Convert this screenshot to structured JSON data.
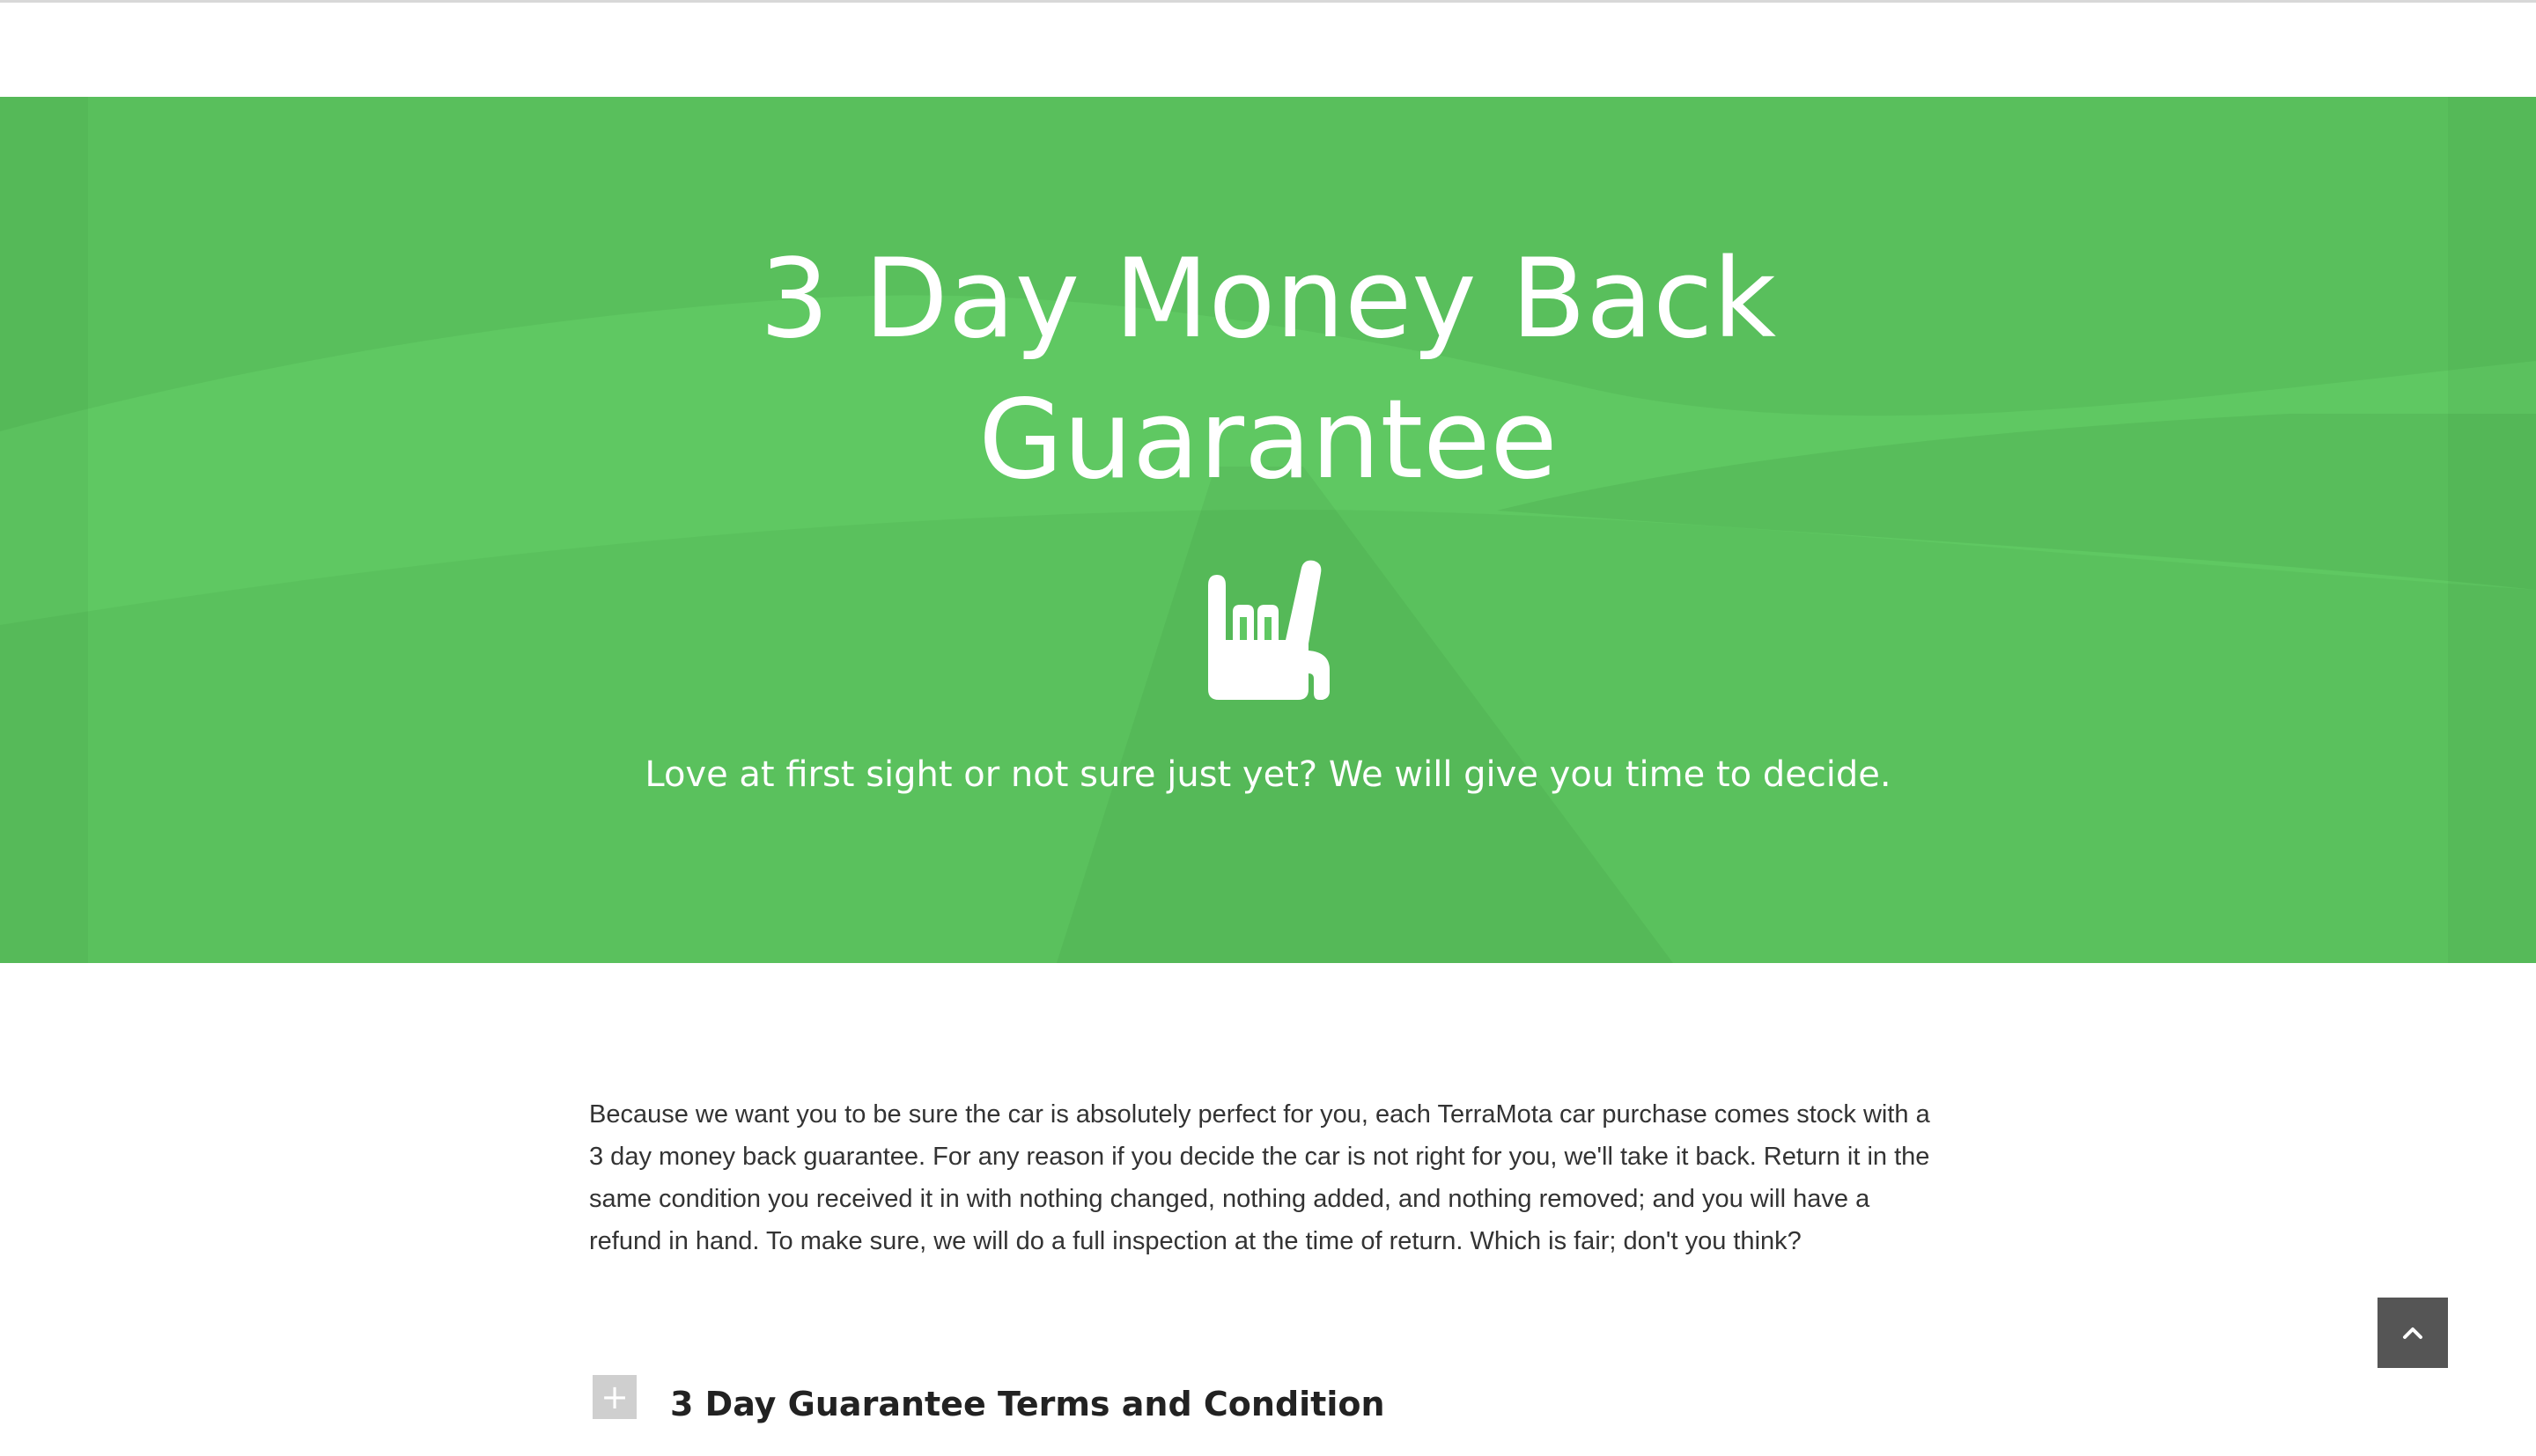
{
  "hero": {
    "title_line1": "3 Day Money Back",
    "title_line2": "Guarantee",
    "icon": "rock-on-hand-icon",
    "subtitle": "Love at first sight or not sure just yet? We will give you time to decide.",
    "background_color": "#5fc862"
  },
  "content": {
    "paragraph": "Because we want you to be sure the car is absolutely perfect for you, each TerraMota car purchase comes stock with a 3 day money back guarantee. For any reason if you decide the car is not right for you, we'll take it back. Return it in the same condition you received it in with nothing changed, nothing added, and nothing removed; and you will have a refund in hand. To make sure, we will do a full inspection at the time of return. Which is fair; don't you think?"
  },
  "accordion": {
    "toggle_symbol": "+",
    "title": "3 Day Guarantee Terms and Condition"
  },
  "scroll_top": {
    "icon": "chevron-up-icon"
  }
}
